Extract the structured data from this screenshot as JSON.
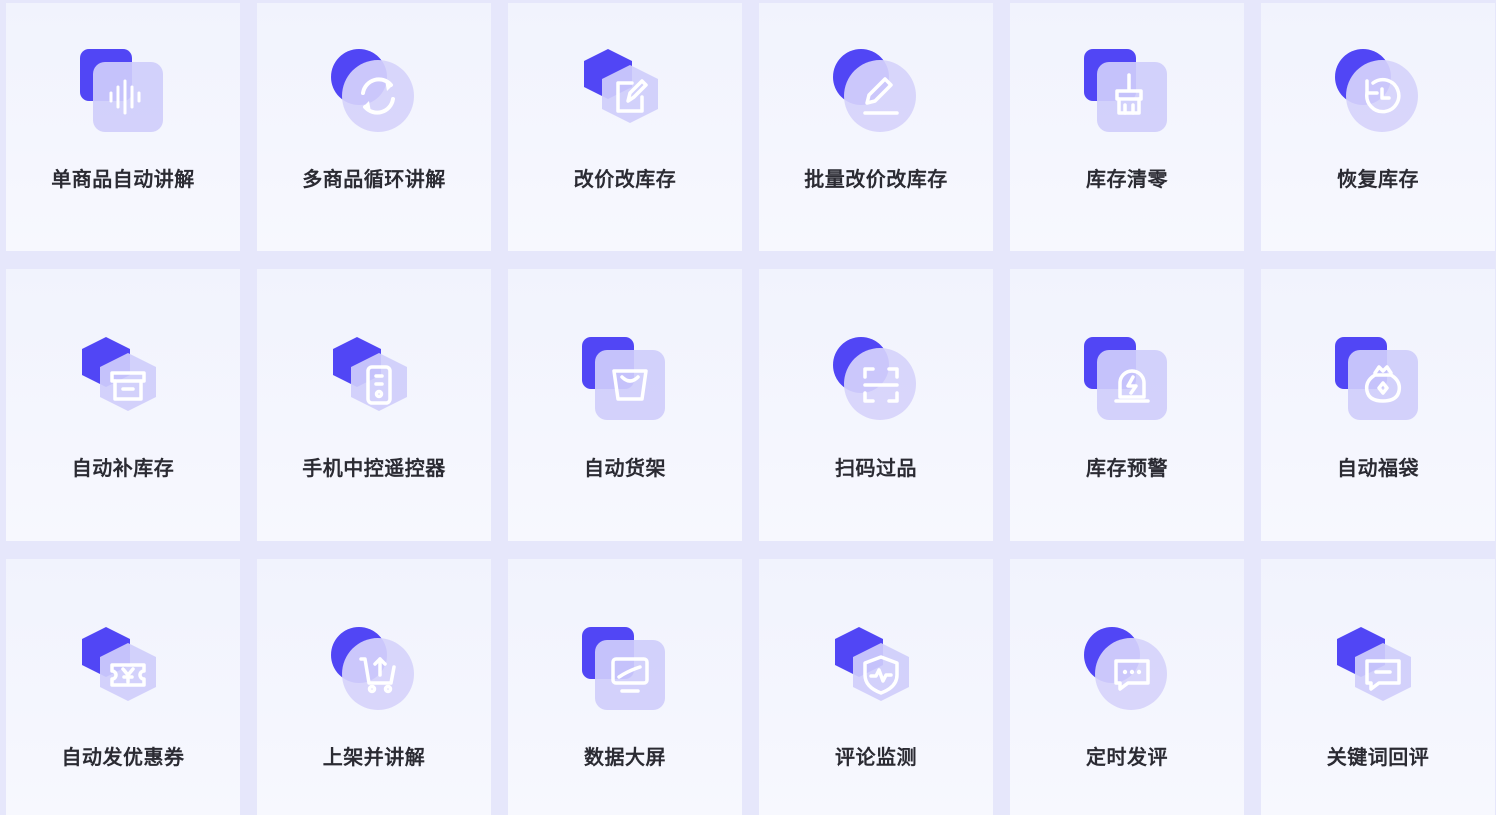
{
  "colors": {
    "accent": "#5146f5",
    "accent_light": "#c9c6fb",
    "card_bg": "#f3f5fd",
    "grid_bg": "#e6e7fb",
    "label": "#2b2b33"
  },
  "tools": [
    {
      "label": "单商品自动讲解",
      "icon": "audio-wave-icon"
    },
    {
      "label": "多商品循环讲解",
      "icon": "refresh-icon"
    },
    {
      "label": "改价改库存",
      "icon": "edit-icon"
    },
    {
      "label": "批量改价改库存",
      "icon": "pen-icon"
    },
    {
      "label": "库存清零",
      "icon": "broom-icon"
    },
    {
      "label": "恢复库存",
      "icon": "restore-icon"
    },
    {
      "label": "自动补库存",
      "icon": "archive-box-icon"
    },
    {
      "label": "手机中控遥控器",
      "icon": "remote-control-icon"
    },
    {
      "label": "自动货架",
      "icon": "shopping-bag-icon"
    },
    {
      "label": "扫码过品",
      "icon": "scan-icon"
    },
    {
      "label": "库存预警",
      "icon": "alarm-icon"
    },
    {
      "label": "自动福袋",
      "icon": "lucky-bag-icon"
    },
    {
      "label": "自动发优惠券",
      "icon": "coupon-icon"
    },
    {
      "label": "上架并讲解",
      "icon": "cart-upload-icon"
    },
    {
      "label": "数据大屏",
      "icon": "monitor-chart-icon"
    },
    {
      "label": "评论监测",
      "icon": "shield-pulse-icon"
    },
    {
      "label": "定时发评",
      "icon": "chat-dots-icon"
    },
    {
      "label": "关键词回评",
      "icon": "chat-reply-icon"
    }
  ]
}
